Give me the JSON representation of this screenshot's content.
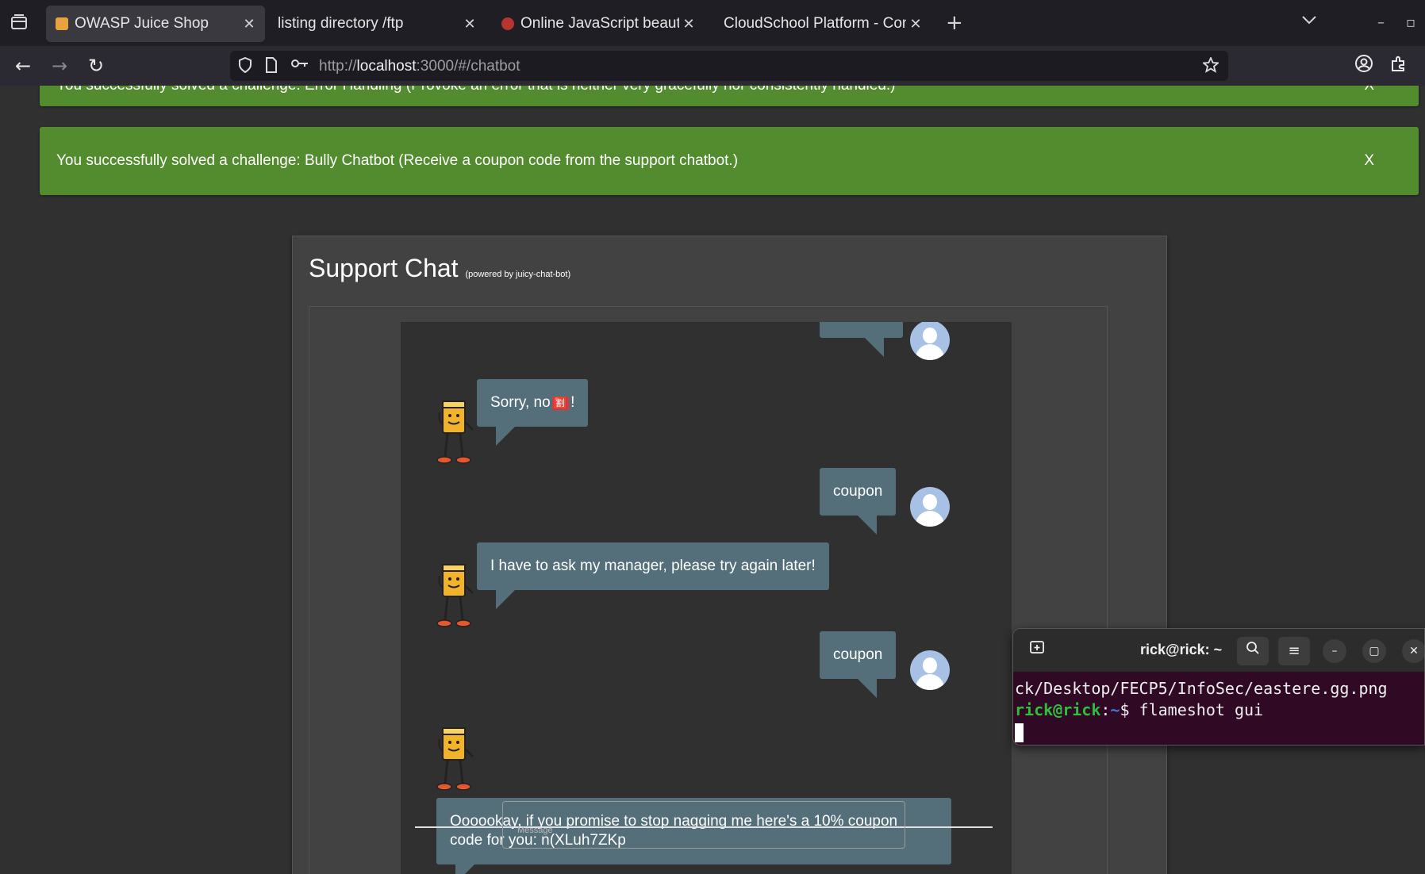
{
  "browser": {
    "tabs": [
      {
        "label": "OWASP Juice Shop",
        "active": true
      },
      {
        "label": "listing directory /ftp",
        "active": false
      },
      {
        "label": "Online JavaScript beautif",
        "active": false
      },
      {
        "label": "CloudSchool Platform - Conti",
        "active": false
      }
    ],
    "url_prefix": "http://",
    "url_host": "localhost",
    "url_rest": ":3000/#/chatbot"
  },
  "toasts": [
    {
      "text": "You successfully solved a challenge: Error Handling (Provoke an error that is neither very gracefully nor consistently handled.)",
      "close": "X"
    },
    {
      "text": "You successfully solved a challenge: Bully Chatbot (Receive a coupon code from the support chatbot.)",
      "close": "X"
    }
  ],
  "chat": {
    "title": "Support Chat",
    "subtitle": "(powered by juicy-chat-bot)",
    "messages": [
      {
        "from": "bot",
        "text_before": "Sorry, no ",
        "emoji": "🈹",
        "text_after": "!"
      },
      {
        "from": "user",
        "text": "coupon"
      },
      {
        "from": "bot",
        "text": "I have to ask my manager, please try again later!"
      },
      {
        "from": "user",
        "text": "coupon"
      },
      {
        "from": "bot",
        "line1": "Oooookay, if you promise to stop nagging me here's a 10% coupon",
        "line2": "code for you: n(XLuh7ZKp"
      }
    ],
    "input_label": "Message"
  },
  "terminal": {
    "title": "rick@rick: ~",
    "line1": "ck/Desktop/FECP5/InfoSec/eastere.gg.png",
    "prompt_user": "rick@rick",
    "prompt_sep": ":",
    "prompt_path": "~",
    "prompt_dollar": "$ ",
    "command": "flameshot gui"
  }
}
